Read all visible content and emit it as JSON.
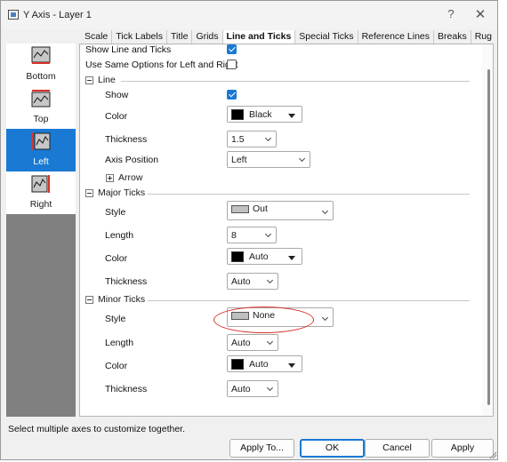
{
  "window": {
    "title": "Y Axis - Layer 1",
    "help_glyph": "?",
    "close_glyph": "✕"
  },
  "tabs": [
    {
      "label": "Scale",
      "active": false
    },
    {
      "label": "Tick Labels",
      "active": false
    },
    {
      "label": "Title",
      "active": false
    },
    {
      "label": "Grids",
      "active": false
    },
    {
      "label": "Line and Ticks",
      "active": true
    },
    {
      "label": "Special Ticks",
      "active": false
    },
    {
      "label": "Reference Lines",
      "active": false
    },
    {
      "label": "Breaks",
      "active": false
    },
    {
      "label": "Rug",
      "active": false
    }
  ],
  "axes": [
    {
      "label": "Bottom",
      "selected": false
    },
    {
      "label": "Top",
      "selected": false
    },
    {
      "label": "Left",
      "selected": true
    },
    {
      "label": "Right",
      "selected": false
    }
  ],
  "general": {
    "show_line_and_ticks_label": "Show Line and Ticks",
    "show_line_and_ticks": true,
    "same_options_label": "Use Same Options for Left and Right",
    "same_options": false
  },
  "line": {
    "section_title": "Line",
    "show_label": "Show",
    "show": true,
    "color_label": "Color",
    "color_value": "Black",
    "thickness_label": "Thickness",
    "thickness_value": "1.5",
    "axis_position_label": "Axis Position",
    "axis_position_value": "Left",
    "arrow_label": "Arrow"
  },
  "major_ticks": {
    "section_title": "Major Ticks",
    "style_label": "Style",
    "style_value": "Out",
    "length_label": "Length",
    "length_value": "8",
    "color_label": "Color",
    "color_value": "Auto",
    "thickness_label": "Thickness",
    "thickness_value": "Auto"
  },
  "minor_ticks": {
    "section_title": "Minor Ticks",
    "style_label": "Style",
    "style_value": "None",
    "length_label": "Length",
    "length_value": "Auto",
    "color_label": "Color",
    "color_value": "Auto",
    "thickness_label": "Thickness",
    "thickness_value": "Auto"
  },
  "colors": {
    "accent": "#1979d3",
    "highlight": "#d9342b",
    "swatch_black": "#000000"
  },
  "status_text": "Select multiple axes to customize together.",
  "buttons": {
    "apply_to": "Apply To...",
    "ok": "OK",
    "cancel": "Cancel",
    "apply": "Apply"
  }
}
